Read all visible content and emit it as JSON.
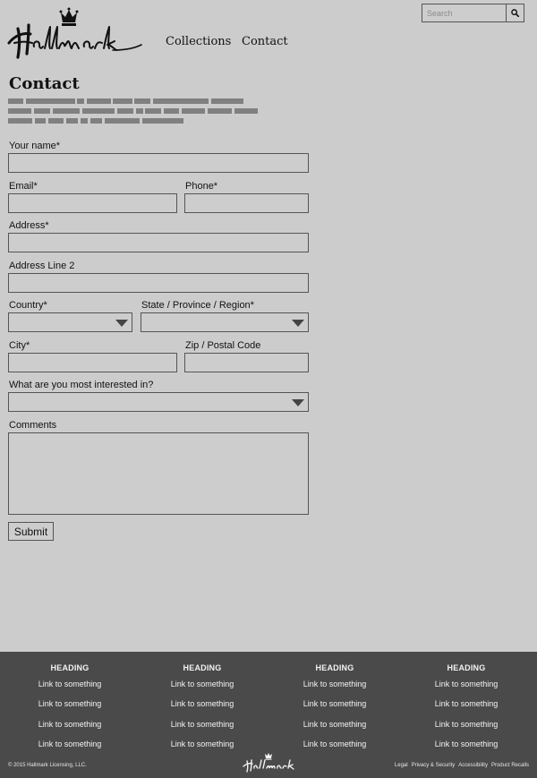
{
  "header": {
    "logo_text": "Hallmark",
    "nav": [
      "Collections",
      "Contact"
    ],
    "search_placeholder": "Search",
    "search_icon": "magnifier-icon"
  },
  "page": {
    "title": "Contact"
  },
  "form": {
    "name_label": "Your name*",
    "email_label": "Email*",
    "phone_label": "Phone*",
    "address_label": "Address*",
    "address2_label": "Address Line 2",
    "country_label": "Country*",
    "state_label": "State / Province / Region*",
    "city_label": "City*",
    "zip_label": "Zip / Postal Code",
    "interest_label": "What are you most interested in?",
    "comments_label": "Comments",
    "submit_label": "Submit"
  },
  "footer": {
    "columns": [
      {
        "heading": "HEADING",
        "links": [
          "Link to something",
          "Link to something",
          "Link to something",
          "Link to something"
        ]
      },
      {
        "heading": "HEADING",
        "links": [
          "Link to something",
          "Link to something",
          "Link to something",
          "Link to something"
        ]
      },
      {
        "heading": "HEADING",
        "links": [
          "Link to something",
          "Link to something",
          "Link to something",
          "Link to something"
        ]
      },
      {
        "heading": "HEADING",
        "links": [
          "Link to something",
          "Link to something",
          "Link to something",
          "Link to something"
        ]
      }
    ],
    "copyright": "© 2015 Hallmark Licensing, LLC.",
    "logo_text": "Hallmark",
    "legal_links": [
      "Legal",
      "Privacy & Security",
      "Accessibility",
      "Product Recalls"
    ]
  },
  "colors": {
    "page_bg": "#cccccc",
    "footer_bg": "#4a4a4a",
    "greeked_text": "#808080"
  }
}
